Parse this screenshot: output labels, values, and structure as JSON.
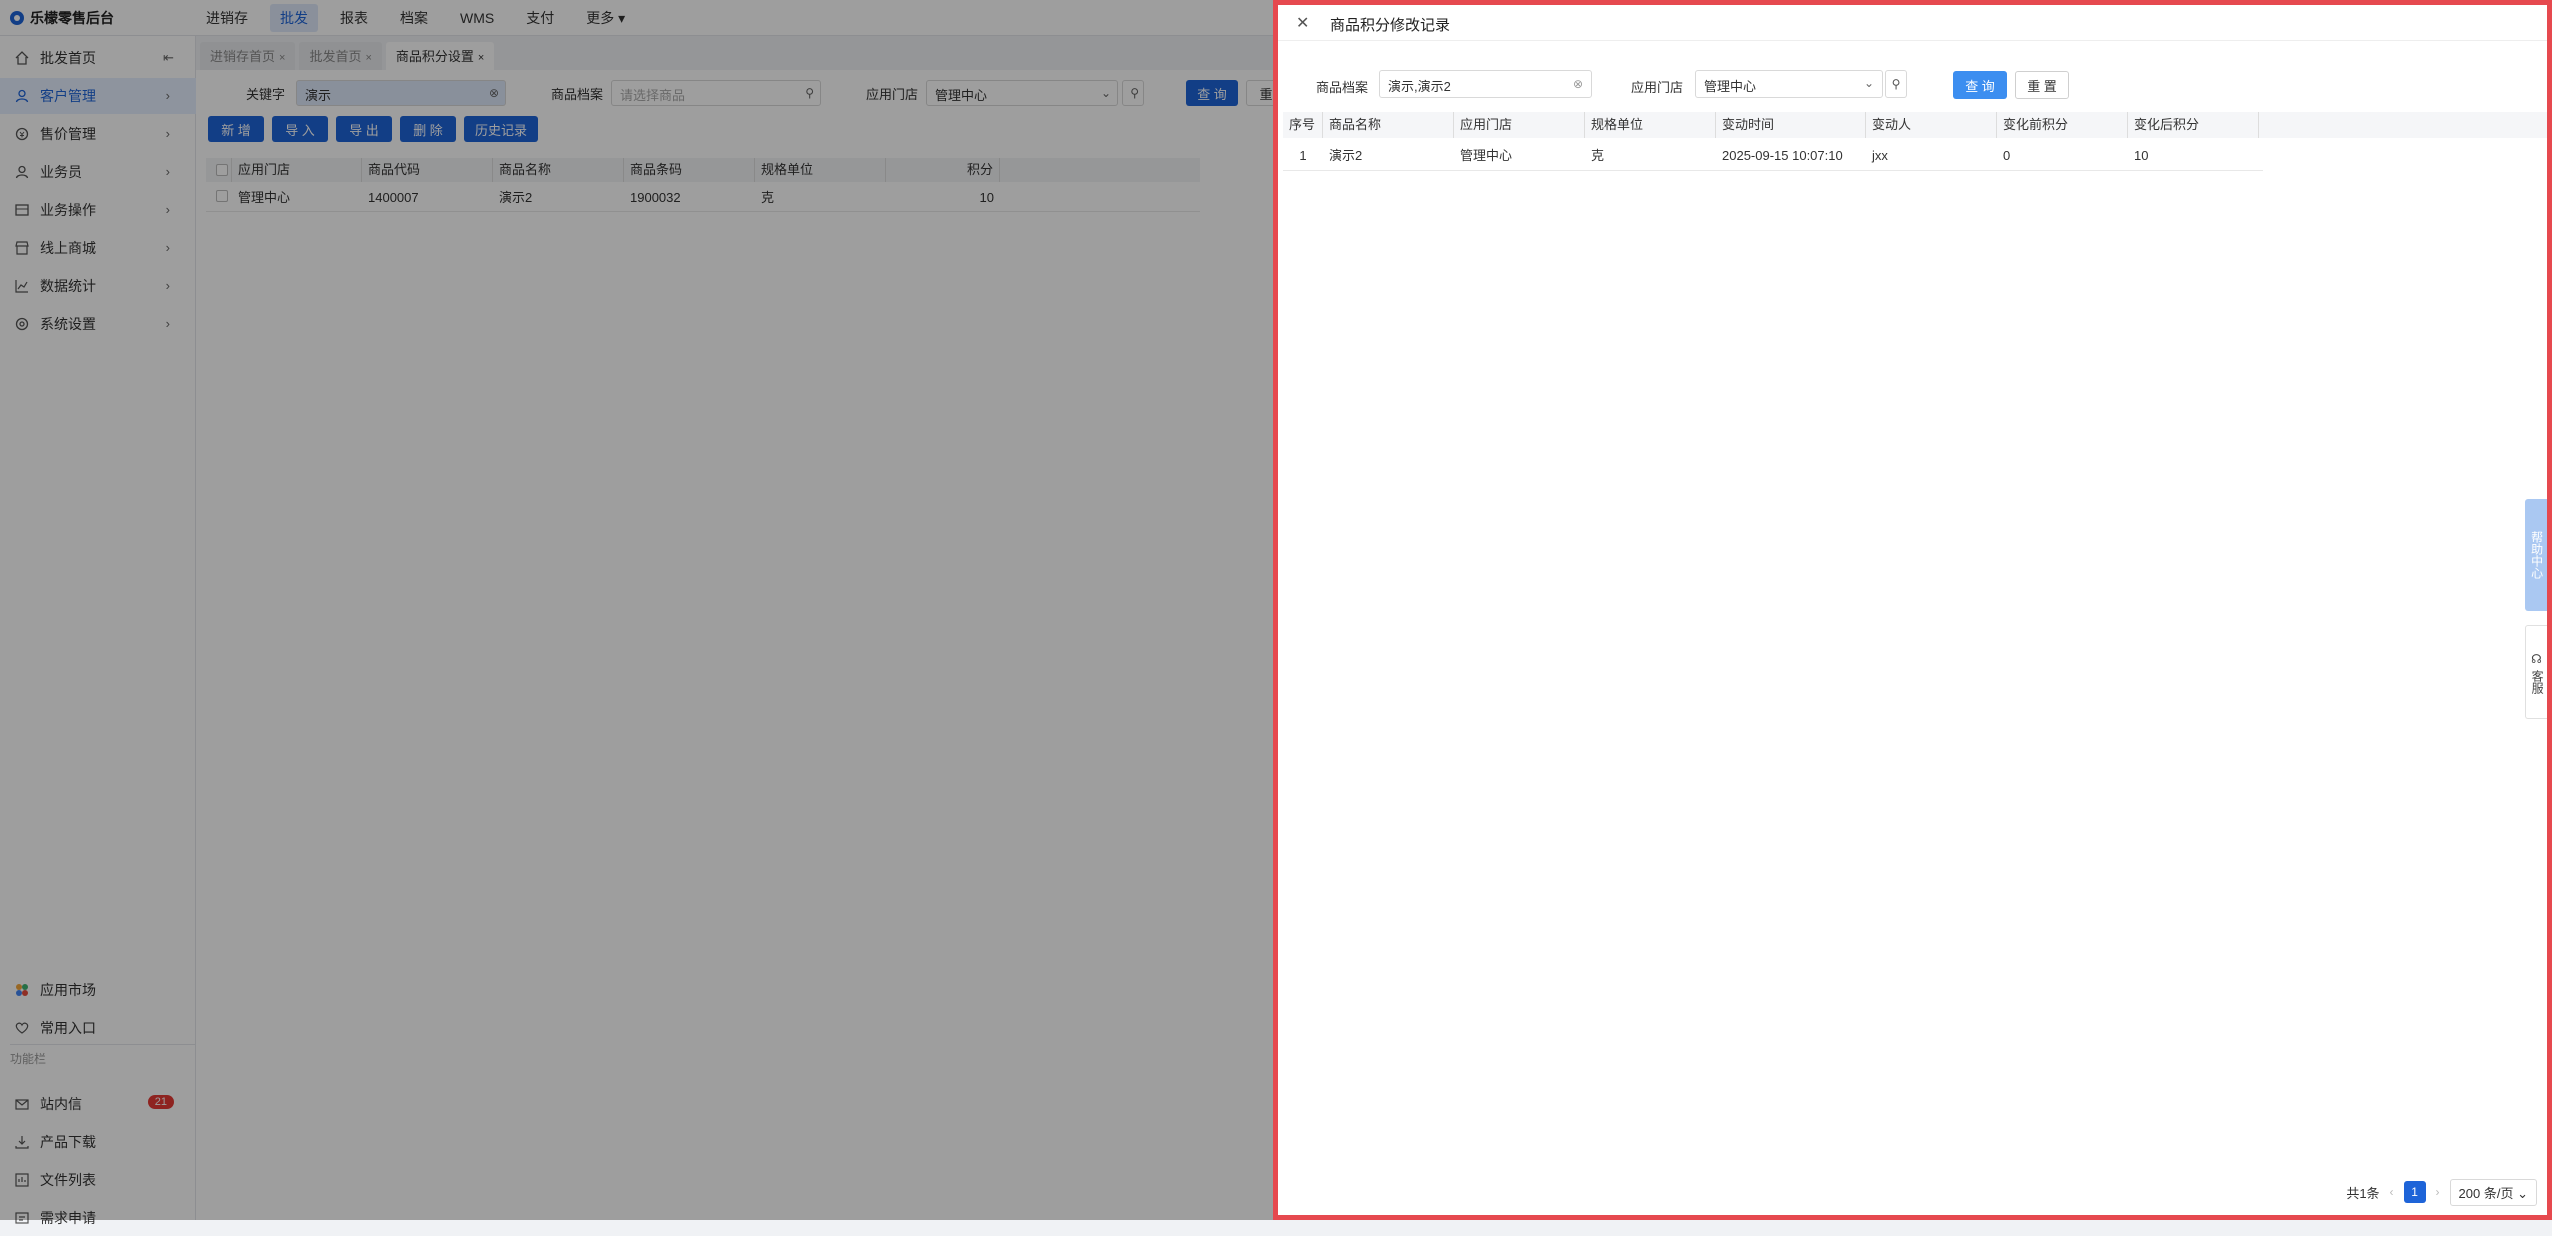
{
  "app": {
    "title": "乐檬零售后台"
  },
  "topnav": [
    "进销存",
    "批发",
    "报表",
    "档案",
    "WMS",
    "支付",
    "更多 ▾"
  ],
  "sidebar": {
    "items": [
      {
        "label": "批发首页",
        "icon": "home-icon"
      },
      {
        "label": "客户管理",
        "icon": "user-icon"
      },
      {
        "label": "售价管理",
        "icon": "price-icon"
      },
      {
        "label": "业务员",
        "icon": "person-icon"
      },
      {
        "label": "业务操作",
        "icon": "operation-icon"
      },
      {
        "label": "线上商城",
        "icon": "shop-icon"
      },
      {
        "label": "数据统计",
        "icon": "chart-icon"
      },
      {
        "label": "系统设置",
        "icon": "gear-icon"
      }
    ],
    "bottom": [
      {
        "label": "应用市场",
        "icon": "app-market-icon"
      },
      {
        "label": "常用入口",
        "icon": "heart-icon"
      }
    ],
    "section_label": "功能栏",
    "tools": [
      {
        "label": "站内信",
        "icon": "mail-icon",
        "badge": "21"
      },
      {
        "label": "产品下载",
        "icon": "download-icon"
      },
      {
        "label": "文件列表",
        "icon": "file-list-icon"
      },
      {
        "label": "需求申请",
        "icon": "request-icon"
      }
    ]
  },
  "tabs": [
    {
      "label": "进销存首页",
      "close": "×"
    },
    {
      "label": "批发首页",
      "close": "×"
    },
    {
      "label": "商品积分设置",
      "close": "×"
    }
  ],
  "filters": {
    "keyword_label": "关键字",
    "keyword_value": "演示",
    "product_label": "商品档案",
    "product_placeholder": "请选择商品",
    "store_label": "应用门店",
    "store_value": "管理中心",
    "query_label": "查 询",
    "reset_label": "重"
  },
  "actions": [
    "新 增",
    "导 入",
    "导 出",
    "删 除",
    "历史记录"
  ],
  "grid": {
    "columns": [
      "应用门店",
      "商品代码",
      "商品名称",
      "商品条码",
      "规格单位",
      "积分"
    ],
    "rows": [
      {
        "store": "管理中心",
        "code": "1400007",
        "name": "演示2",
        "barcode": "1900032",
        "unit": "克",
        "points": "10"
      }
    ]
  },
  "drawer": {
    "title": "商品积分修改记录",
    "product_label": "商品档案",
    "product_value": "演示,演示2",
    "store_label": "应用门店",
    "store_value": "管理中心",
    "query_label": "查 询",
    "reset_label": "重 置",
    "columns": [
      "序号",
      "商品名称",
      "应用门店",
      "规格单位",
      "变动时间",
      "变动人",
      "变化前积分",
      "变化后积分"
    ],
    "rows": [
      {
        "index": "1",
        "name": "演示2",
        "store": "管理中心",
        "unit": "克",
        "time": "2025-09-15 10:07:10",
        "operator": "jxx",
        "before": "0",
        "after": "10"
      }
    ],
    "pagination": {
      "total": "共1条",
      "current": "1",
      "page_size": "200 条/页"
    }
  },
  "right_tabs": {
    "help": "帮助中心",
    "service": "客服"
  }
}
